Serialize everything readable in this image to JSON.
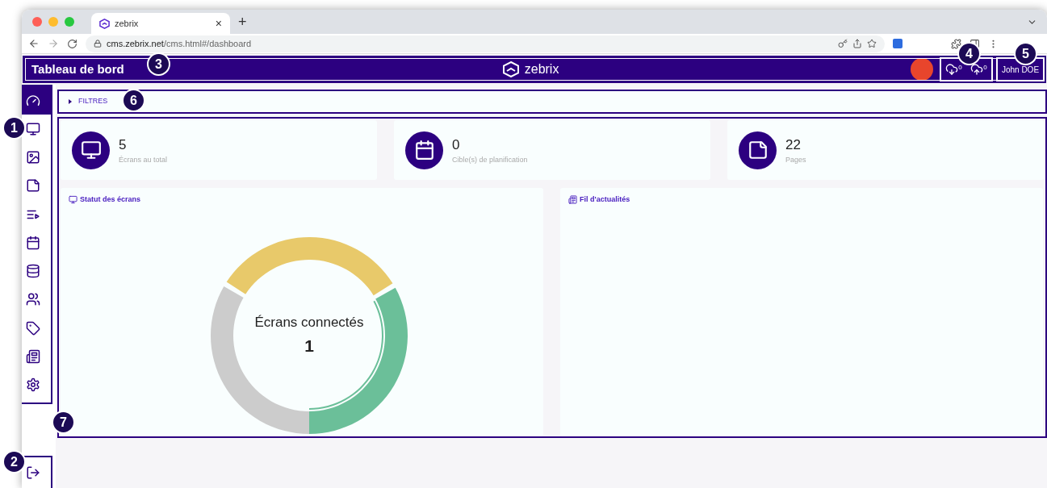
{
  "browser": {
    "tab_title": "zebrix",
    "tab_close": "×",
    "new_tab": "+",
    "url_host": "cms.zebrix.net",
    "url_path": "/cms.html#/dashboard"
  },
  "header": {
    "title": "Tableau de bord",
    "logo": "zebrix",
    "download_count": "0",
    "upload_count": "0",
    "user": "John DOE"
  },
  "sidebar": {
    "items": [
      {
        "selected": true
      },
      {
        "selected": false
      },
      {
        "selected": false
      },
      {
        "selected": false
      },
      {
        "selected": false
      },
      {
        "selected": false
      },
      {
        "selected": false
      },
      {
        "selected": false
      },
      {
        "selected": false
      },
      {
        "selected": false
      },
      {
        "selected": false
      }
    ]
  },
  "filters": {
    "label": "FILTRES",
    "expanded": false
  },
  "stats": [
    {
      "value": "5",
      "label": "Écrans au total"
    },
    {
      "value": "0",
      "label": "Cible(s) de planification"
    },
    {
      "value": "22",
      "label": "Pages"
    }
  ],
  "panels": [
    {
      "title": "Statut des écrans",
      "center_label": "Écrans connectés",
      "center_value": "1"
    },
    {
      "title": "Fil d'actualités"
    }
  ],
  "annotations": [
    "1",
    "2",
    "3",
    "4",
    "5",
    "6",
    "7"
  ]
}
